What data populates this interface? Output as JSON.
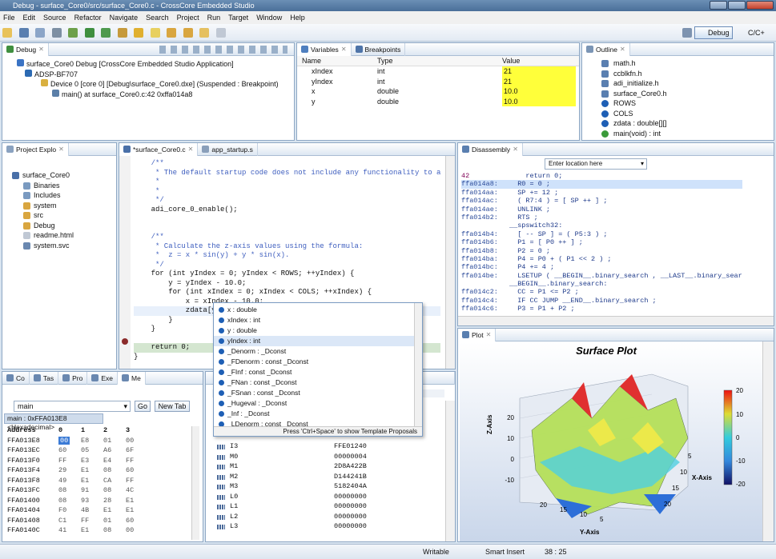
{
  "window": {
    "title": "Debug - surface_Core0/src/surface_Core0.c - CrossCore Embedded Studio"
  },
  "menu": [
    "File",
    "Edit",
    "Source",
    "Refactor",
    "Navigate",
    "Search",
    "Project",
    "Run",
    "Target",
    "Window",
    "Help"
  ],
  "perspectives": {
    "debug": "Debug",
    "cc": "C/C+"
  },
  "debug_view": {
    "tab": "Debug",
    "tree": [
      "surface_Core0 Debug [CrossCore Embedded Studio Application]",
      "ADSP-BF707",
      "Device 0 [core 0] [Debug\\surface_Core0.dxe] (Suspended : Breakpoint)",
      "main() at surface_Core0.c:42 0xffa014a8"
    ]
  },
  "variables": {
    "tabs": [
      "Variables",
      "Breakpoints"
    ],
    "headers": [
      "Name",
      "Type",
      "Value"
    ],
    "rows": [
      [
        "xIndex",
        "int",
        "21"
      ],
      [
        "yIndex",
        "int",
        "21"
      ],
      [
        "x",
        "double",
        "10.0"
      ],
      [
        "y",
        "double",
        "10.0"
      ]
    ]
  },
  "outline": {
    "tab": "Outline",
    "items": [
      "math.h",
      "ccblkfn.h",
      "adi_initialize.h",
      "surface_Core0.h",
      "ROWS",
      "COLS",
      "zdata : double[][]",
      "main(void) : int"
    ],
    "item_colors": [
      "#5a7fb0",
      "#5a7fb0",
      "#5a7fb0",
      "#5a7fb0",
      "#1e5fb5",
      "#1e5fb5",
      "#1e5fb5",
      "#3a9a3a"
    ]
  },
  "project": {
    "tab": "Project Explo",
    "items": [
      "surface_Core0",
      "Binaries",
      "Includes",
      "system",
      "src",
      "Debug",
      "readme.html",
      "system.svc"
    ]
  },
  "editor": {
    "tabs": [
      "*surface_Core0.c",
      "app_startup.s"
    ],
    "lines": [
      {
        "t": "    /**",
        "c": "cm"
      },
      {
        "t": "     * The default startup code does not include any functionality to a",
        "c": "cm"
      },
      {
        "t": "     *",
        "c": "cm"
      },
      {
        "t": "     *",
        "c": "cm"
      },
      {
        "t": "     */",
        "c": "cm"
      },
      {
        "t": "    adi_core_0_enable();",
        "c": ""
      },
      {
        "t": "",
        "c": ""
      },
      {
        "t": "",
        "c": ""
      },
      {
        "t": "    /**",
        "c": "cm"
      },
      {
        "t": "     * Calculate the z-axis values using the formula:",
        "c": "cm"
      },
      {
        "t": "     *  z = x * sin(y) + y * sin(x).",
        "c": "cm"
      },
      {
        "t": "     */",
        "c": "cm"
      },
      {
        "t": "    for (int yIndex = 0; yIndex < ROWS; ++yIndex) {",
        "c": ""
      },
      {
        "t": "        y = yIndex - 10.0;",
        "c": ""
      },
      {
        "t": "        for (int xIndex = 0; xIndex < COLS; ++xIndex) {",
        "c": ""
      },
      {
        "t": "            x = xIndex - 10.0;",
        "c": ""
      },
      {
        "t": "            zdata[yIndex][xIndex] = x * sin(y) + y * sin(x);",
        "c": ""
      },
      {
        "t": "        }",
        "c": ""
      },
      {
        "t": "    }",
        "c": ""
      },
      {
        "t": "",
        "c": ""
      },
      {
        "t": "    return 0;",
        "c": ""
      },
      {
        "t": "}",
        "c": ""
      }
    ]
  },
  "autocomplete": {
    "items": [
      "x : double",
      "xIndex : int",
      "y : double",
      "yIndex : int",
      "_Denorm : _Dconst",
      "_FDenorm : const _Dconst",
      "_FInf : const _Dconst",
      "_FNan : const _Dconst",
      "_FSnan : const _Dconst",
      "_Hugeval : _Dconst",
      "_Inf : _Dconst",
      "_LDenorm : const _Dconst"
    ],
    "hint": "Press 'Ctrl+Space' to show Template Proposals"
  },
  "disassembly": {
    "tab": "Disassembly",
    "location_placeholder": "Enter location here",
    "lines": [
      [
        "42",
        "    return 0;"
      ],
      [
        "ffa014a8:",
        "  R0 = 0 ;"
      ],
      [
        "ffa014aa:",
        "  SP += 12 ;"
      ],
      [
        "ffa014ac:",
        "  ( R7:4 ) = [ SP ++ ] ;"
      ],
      [
        "ffa014ae:",
        "  UNLINK ;"
      ],
      [
        "ffa014b2:",
        "  RTS ;"
      ],
      [
        "",
        "__spswitch32:"
      ],
      [
        "ffa014b4:",
        "  [ -- SP ] = ( P5:3 ) ;"
      ],
      [
        "ffa014b6:",
        "  P1 = [ P0 ++ ] ;"
      ],
      [
        "ffa014b8:",
        "  P2 = 0 ;"
      ],
      [
        "ffa014ba:",
        "  P4 = P0 + ( P1 << 2 ) ;"
      ],
      [
        "ffa014bc:",
        "  P4 += 4 ;"
      ],
      [
        "ffa014be:",
        "  LSETUP ( __BEGIN__.binary_search , __LAST__.binary_sear"
      ],
      [
        "",
        "__BEGIN__.binary_search:"
      ],
      [
        "ffa014c2:",
        "  CC = P1 <= P2 ;"
      ],
      [
        "ffa014c4:",
        "  IF CC JUMP __END__.binary_search ;"
      ],
      [
        "ffa014c6:",
        "  P3 = P1 + P2 ;"
      ]
    ]
  },
  "plot": {
    "tab": "Plot",
    "title": "Surface Plot",
    "zlabel": "Z-Axis",
    "ylabel": "Y-Axis",
    "xlabel": "X-Axis",
    "zticks": [
      "20",
      "10",
      "0",
      "-10"
    ],
    "yticks": [
      "20",
      "15",
      "10",
      "5"
    ],
    "xticks": [
      "20",
      "15",
      "10",
      "5"
    ],
    "colorbar": [
      "20",
      "10",
      "0",
      "-10",
      "-20"
    ]
  },
  "memory": {
    "tabs": [
      "Co",
      "Tas",
      "Pro",
      "Exe",
      "Me"
    ],
    "expression": "main",
    "go": "Go",
    "new_tab": "New Tab",
    "rendering": "main : 0xFFA013E8 <Hexadecimal>",
    "headers": [
      "Address",
      "0",
      "1",
      "2",
      "3"
    ],
    "rows": [
      [
        "FFA013E8",
        "00",
        "E8",
        "01",
        "00"
      ],
      [
        "FFA013EC",
        "60",
        "05",
        "A6",
        "6F"
      ],
      [
        "FFA013F0",
        "FF",
        "E3",
        "E4",
        "FF"
      ],
      [
        "FFA013F4",
        "29",
        "E1",
        "08",
        "60"
      ],
      [
        "FFA013F8",
        "49",
        "E1",
        "CA",
        "FF"
      ],
      [
        "FFA013FC",
        "08",
        "91",
        "08",
        "4C"
      ],
      [
        "FFA01400",
        "08",
        "93",
        "28",
        "E1"
      ],
      [
        "FFA01404",
        "F0",
        "4B",
        "E1",
        "E1"
      ],
      [
        "FFA01408",
        "C1",
        "FF",
        "01",
        "60"
      ],
      [
        "FFA0140C",
        "41",
        "E1",
        "08",
        "00"
      ]
    ]
  },
  "registers": {
    "rows": [
      [
        "I3",
        "FFE01240"
      ],
      [
        "M0",
        "00000004"
      ],
      [
        "M1",
        "2D8A422B"
      ],
      [
        "M2",
        "D144241B"
      ],
      [
        "M3",
        "5182404A"
      ],
      [
        "L0",
        "00000000"
      ],
      [
        "L1",
        "00000000"
      ],
      [
        "L2",
        "00000000"
      ],
      [
        "L3",
        "00000000"
      ]
    ]
  },
  "status": {
    "writable": "Writable",
    "insert": "Smart Insert",
    "position": "38 : 25"
  }
}
